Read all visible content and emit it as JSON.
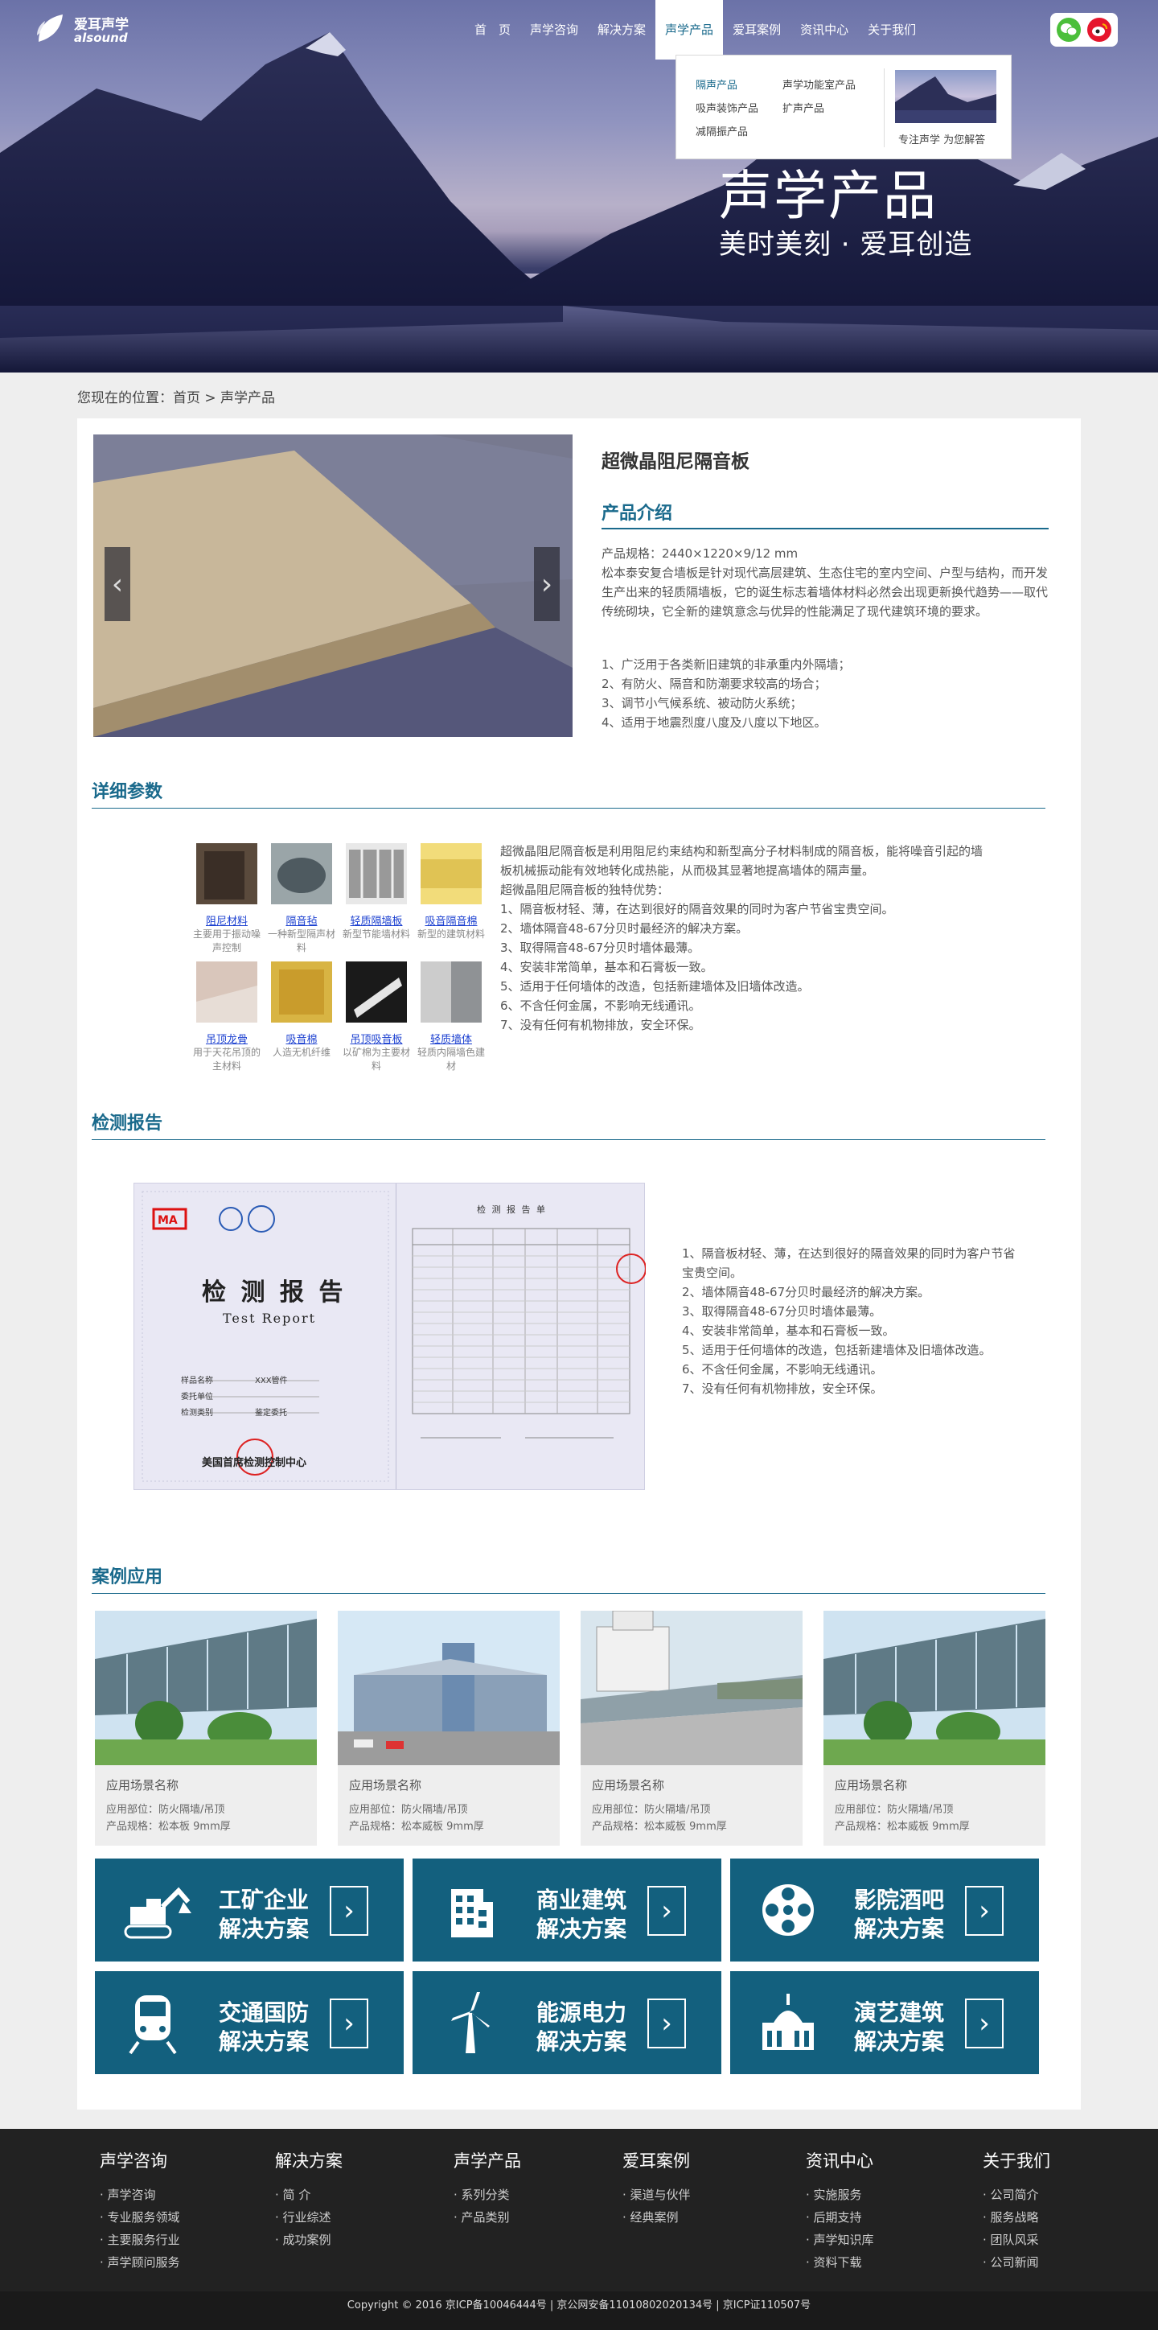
{
  "header": {
    "logo_cn": "爱耳声学",
    "logo_en": "alsound",
    "nav": [
      "首　页",
      "声学咨询",
      "解决方案",
      "声学产品",
      "爱耳案例",
      "资讯中心",
      "关于我们"
    ],
    "active_nav": "声学产品",
    "dropdown": {
      "links": [
        "隔声产品",
        "声学功能室产品",
        "吸声装饰产品",
        "扩声产品",
        "减隔振产品"
      ],
      "caption": "专注声学 为您解答"
    },
    "hero_title": "声学产品",
    "hero_subtitle": "美时美刻 · 爱耳创造",
    "social": [
      "wechat-icon",
      "weibo-icon"
    ]
  },
  "breadcrumb": "您现在的位置：首页 > 声学产品",
  "product": {
    "name": "超微晶阻尼隔音板",
    "intro_title": "产品介绍",
    "spec": "产品规格：2440×1220×9/12 mm",
    "intro": "松本泰安复合墙板是针对现代高层建筑、生态住宅的室内空间、户型与结构，而开发生产出来的轻质隔墙板，它的诞生标志着墙体材料必然会出现更新换代趋势——取代传统砌块，它全新的建筑意念与优异的性能满足了现代建筑环境的要求。",
    "features": [
      "1、广泛用于各类新旧建筑的非承重内外隔墙；",
      "2、有防火、隔音和防潮要求较高的场合；",
      "3、调节小气候系统、被动防火系统；",
      "4、适用于地震烈度八度及八度以下地区。"
    ]
  },
  "details": {
    "title": "详细参数",
    "materials": [
      {
        "name": "阻尼材料",
        "desc": "主要用于振动噪声控制"
      },
      {
        "name": "隔音毡",
        "desc": "一种新型隔声材料"
      },
      {
        "name": "轻质隔墙板",
        "desc": "新型节能墙材料"
      },
      {
        "name": "吸音隔音棉",
        "desc": "新型的建筑材料"
      },
      {
        "name": "吊顶龙骨",
        "desc": "用于天花吊顶的主材料"
      },
      {
        "name": "吸音棉",
        "desc": "人造无机纤维"
      },
      {
        "name": "吊顶吸音板",
        "desc": "以矿棉为主要材料"
      },
      {
        "name": "轻质墙体",
        "desc": "轻质内隔墙色建材"
      }
    ],
    "text": [
      "超微晶阻尼隔音板是利用阻尼约束结构和新型高分子材料制成的隔音板，能将噪音引起的墙板机械振动能有效地转化成热能，从而极其显著地提高墙体的隔声量。",
      "超微晶阻尼隔音板的独特优势：",
      "1、隔音板材轻、薄，在达到很好的隔音效果的同时为客户节省宝贵空间。",
      "2、墙体隔音48-67分贝时最经济的解决方案。",
      "3、取得隔音48-67分贝时墙体最薄。",
      "4、安装非常简单，基本和石膏板一致。",
      "5、适用于任何墙体的改造，包括新建墙体及旧墙体改造。",
      "6、不含任何金属，不影响无线通讯。",
      "7、没有任何有机物排放，安全环保。"
    ]
  },
  "report": {
    "title": "检测报告",
    "doc_title": "检 测 报 告",
    "doc_title_en": "Test Report",
    "doc_right_title": "检 测 报 告 单",
    "doc_fields": [
      "样品名称",
      "委托单位",
      "检测类别"
    ],
    "doc_values": [
      "XXX管件",
      "",
      "鉴定委托"
    ],
    "doc_org": "美国首席检测控制中心",
    "list": [
      "1、隔音板材轻、薄，在达到很好的隔音效果的同时为客户节省宝贵空间。",
      "2、墙体隔音48-67分贝时最经济的解决方案。",
      "3、取得隔音48-67分贝时墙体最薄。",
      "4、安装非常简单，基本和石膏板一致。",
      "5、适用于任何墙体的改造，包括新建墙体及旧墙体改造。",
      "6、不含任何金属，不影响无线通讯。",
      "7、没有任何有机物排放，安全环保。"
    ]
  },
  "cases": {
    "title": "案例应用",
    "items": [
      {
        "title": "应用场景名称",
        "part": "应用部位：防火隔墙/吊顶",
        "spec": "产品规格：松本板 9mm厚"
      },
      {
        "title": "应用场景名称",
        "part": "应用部位：防火隔墙/吊顶",
        "spec": "产品规格：松本威板 9mm厚"
      },
      {
        "title": "应用场景名称",
        "part": "应用部位：防火隔墙/吊顶",
        "spec": "产品规格：松本威板 9mm厚"
      },
      {
        "title": "应用场景名称",
        "part": "应用部位：防火隔墙/吊顶",
        "spec": "产品规格：松本威板 9mm厚"
      }
    ]
  },
  "solutions": [
    {
      "l1": "工矿企业",
      "l2": "解决方案",
      "icon": "excavator-icon"
    },
    {
      "l1": "商业建筑",
      "l2": "解决方案",
      "icon": "building-icon"
    },
    {
      "l1": "影院酒吧",
      "l2": "解决方案",
      "icon": "film-reel-icon"
    },
    {
      "l1": "交通国防",
      "l2": "解决方案",
      "icon": "train-icon"
    },
    {
      "l1": "能源电力",
      "l2": "解决方案",
      "icon": "wind-turbine-icon"
    },
    {
      "l1": "演艺建筑",
      "l2": "解决方案",
      "icon": "theater-icon"
    }
  ],
  "footer": {
    "cols": [
      {
        "h": "声学咨询",
        "items": [
          "声学咨询",
          "专业服务领域",
          "主要服务行业",
          "声学顾问服务"
        ]
      },
      {
        "h": "解决方案",
        "items": [
          "简 介",
          "行业综述",
          "成功案例"
        ]
      },
      {
        "h": "声学产品",
        "items": [
          "系列分类",
          "产品类别"
        ]
      },
      {
        "h": "爱耳案例",
        "items": [
          "渠道与伙伴",
          "经典案例"
        ]
      },
      {
        "h": "资讯中心",
        "items": [
          "实施服务",
          "后期支持",
          "声学知识库",
          "资料下载"
        ]
      },
      {
        "h": "关于我们",
        "items": [
          "公司简介",
          "服务战略",
          "团队风采",
          "公司新闻"
        ]
      }
    ],
    "copyright": "Copyright © 2016  京ICP备10046444号 | 京公网安备11010802020134号 | 京ICP证110507号"
  },
  "colors": {
    "accent": "#1a6a8c",
    "solution_bg": "#13607e",
    "footer_bg": "#222222"
  }
}
